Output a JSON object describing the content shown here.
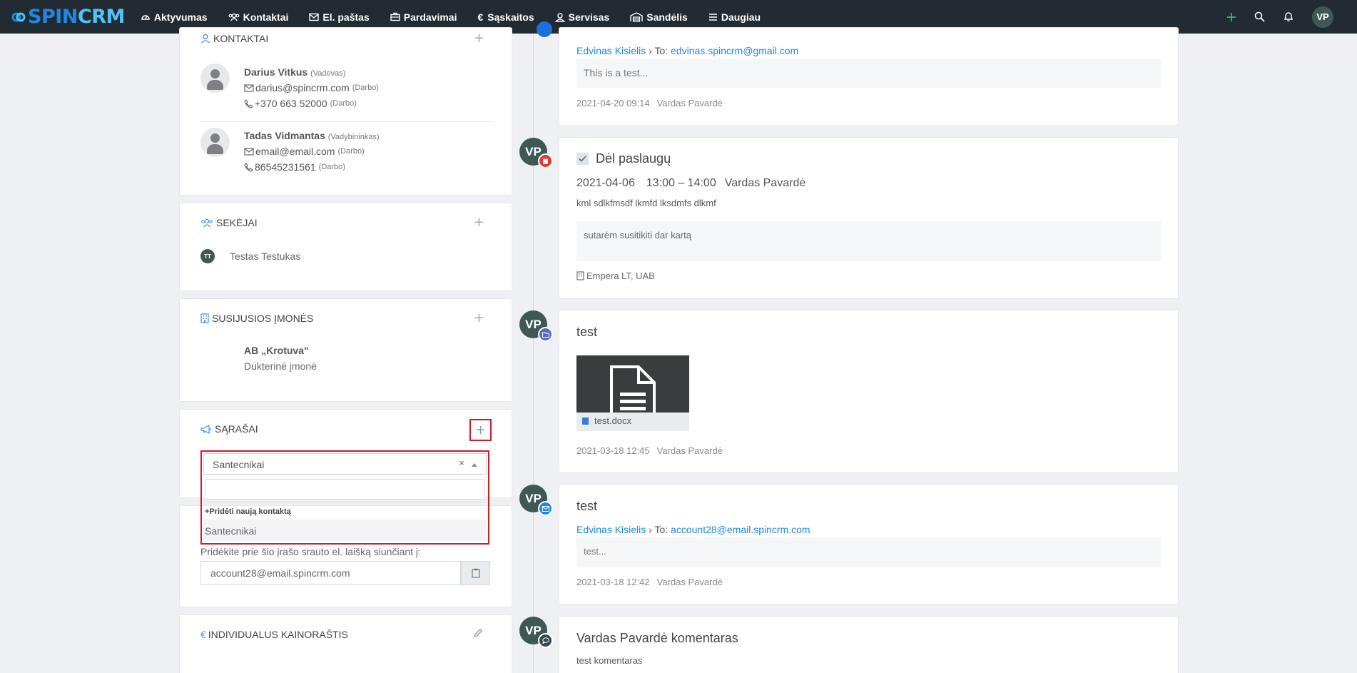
{
  "nav": {
    "logo_a": "SPIN",
    "logo_b": "CRM",
    "items": [
      {
        "label": "Aktyvumas",
        "icon": "gauge-icon"
      },
      {
        "label": "Kontaktai",
        "icon": "users-icon"
      },
      {
        "label": "El. paštas",
        "icon": "envelope-icon"
      },
      {
        "label": "Pardavimai",
        "icon": "briefcase-icon"
      },
      {
        "label": "Sąskaitos",
        "icon": "euro-icon"
      },
      {
        "label": "Servisas",
        "icon": "user-headset-icon"
      },
      {
        "label": "Sandėlis",
        "icon": "warehouse-icon"
      },
      {
        "label": "Daugiau",
        "icon": "menu-icon"
      }
    ],
    "user_initials": "VP"
  },
  "contacts_card": {
    "title": "KONTAKTAI",
    "contacts": [
      {
        "name": "Darius Vitkus",
        "role": "(Vadovas)",
        "email": "darius@spincrm.com",
        "email_type": "(Darbo)",
        "phone": "+370 663 52000",
        "phone_type": "(Darbo)"
      },
      {
        "name": "Tadas Vidmantas",
        "role": "(Vadybininkas)",
        "email": "email@email.com",
        "email_type": "(Darbo)",
        "phone": "86545231561",
        "phone_type": "(Darbo)"
      }
    ]
  },
  "followers_card": {
    "title": "SEKĖJAI",
    "follower_initials": "TT",
    "follower_name": "Testas Testukas"
  },
  "companies_card": {
    "title": "SUSIJUSIOS ĮMONĖS",
    "company_name": "AB „Krotuva\"",
    "company_relation": "Dukterinė įmonė"
  },
  "lists_card": {
    "title": "SĄRAŠAI",
    "selected": "Santecnikai",
    "clear": "×",
    "add_new": "+Pridėti naują kontaktą",
    "option": "Santecnikai"
  },
  "email_card": {
    "hint": "Pridėkite prie šio įrašo srauto el. laišką siunčiant į:",
    "address": "account28@email.spincrm.com"
  },
  "pricing_card": {
    "title": "INDIVIDUALUS KAINORAŠTIS"
  },
  "timeline": {
    "email1": {
      "from": "Edvinas Kisielis",
      "to_label": "To:",
      "to": "edvinas.spincrm@gmail.com",
      "body": "This is a test...",
      "date": "2021-04-20 09:14",
      "author": "Vardas Pavardė"
    },
    "task": {
      "initials": "VP",
      "title": "Dėl paslaugų",
      "date": "2021-04-06",
      "time": "13:00 – 14:00",
      "author": "Vardas Pavardė",
      "description": "kml sdlkfmsdf lkmfd lksdmfs dlkmf",
      "note": "sutarėm susitikiti dar kartą",
      "company": "Empera LT, UAB"
    },
    "file": {
      "initials": "VP",
      "title": "test",
      "filename": "test.docx",
      "date": "2021-03-18 12:45",
      "author": "Vardas Pavardė"
    },
    "email2": {
      "initials": "VP",
      "title": "test",
      "from": "Edvinas Kisielis",
      "to_label": "To:",
      "to": "account28@email.spincrm.com",
      "body": "test...",
      "date": "2021-03-18 12:42",
      "author": "Vardas Pavardė"
    },
    "comment": {
      "initials": "VP",
      "title": "Vardas Pavardė komentaras",
      "body": "test komentaras"
    }
  }
}
